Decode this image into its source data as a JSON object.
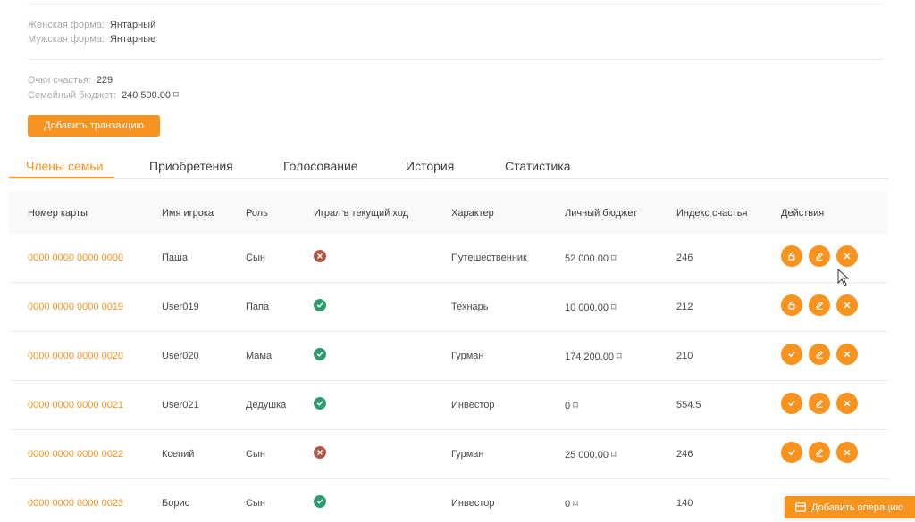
{
  "info": {
    "female_form_label": "Женская форма:",
    "female_form_value": "Янтарный",
    "male_form_label": "Мужская форма:",
    "male_form_value": "Янтарные",
    "happiness_points_label": "Очки счастья:",
    "happiness_points_value": "229",
    "family_budget_label": "Семейный бюджет:",
    "family_budget_value": "240 500.00 ⌑"
  },
  "add_transaction_label": "Добавить транзакцию",
  "tabs": [
    {
      "label": "Члены семьи",
      "active": true
    },
    {
      "label": "Приобретения",
      "active": false
    },
    {
      "label": "Голосование",
      "active": false
    },
    {
      "label": "История",
      "active": false
    },
    {
      "label": "Статистика",
      "active": false
    }
  ],
  "table": {
    "headers": [
      "Номер карты",
      "Имя игрока",
      "Роль",
      "Играл в текущий ход",
      "Характер",
      "Личный бюджет",
      "Индекс счастья",
      "Действия"
    ],
    "rows": [
      {
        "card": "0000 0000 0000 0000",
        "name": "Паша",
        "role": "Сын",
        "played": false,
        "character": "Путешественник",
        "budget": "52 000.00 ⌑",
        "index": "246",
        "first_action": "lock"
      },
      {
        "card": "0000 0000 0000 0019",
        "name": "User019",
        "role": "Папа",
        "played": true,
        "character": "Технарь",
        "budget": "10 000.00 ⌑",
        "index": "212",
        "first_action": "lock"
      },
      {
        "card": "0000 0000 0000 0020",
        "name": "User020",
        "role": "Мама",
        "played": true,
        "character": "Гурман",
        "budget": "174 200.00 ⌑",
        "index": "210",
        "first_action": "check"
      },
      {
        "card": "0000 0000 0000 0021",
        "name": "User021",
        "role": "Дедушка",
        "played": true,
        "character": "Инвестор",
        "budget": "0 ⌑",
        "index": "554.5",
        "first_action": "check"
      },
      {
        "card": "0000 0000 0000 0022",
        "name": "Ксений",
        "role": "Сын",
        "played": false,
        "character": "Гурман",
        "budget": "25 000.00 ⌑",
        "index": "246",
        "first_action": "check"
      },
      {
        "card": "0000 0000 0000 0023",
        "name": "Борис",
        "role": "Сын",
        "played": true,
        "character": "Инвестор",
        "budget": "0 ⌑",
        "index": "140",
        "first_action": "none"
      }
    ]
  },
  "add_operation_label": "Добавить операцию",
  "colors": {
    "accent": "#f7931e",
    "ok": "#2e9b6e",
    "no": "#b0574a"
  }
}
